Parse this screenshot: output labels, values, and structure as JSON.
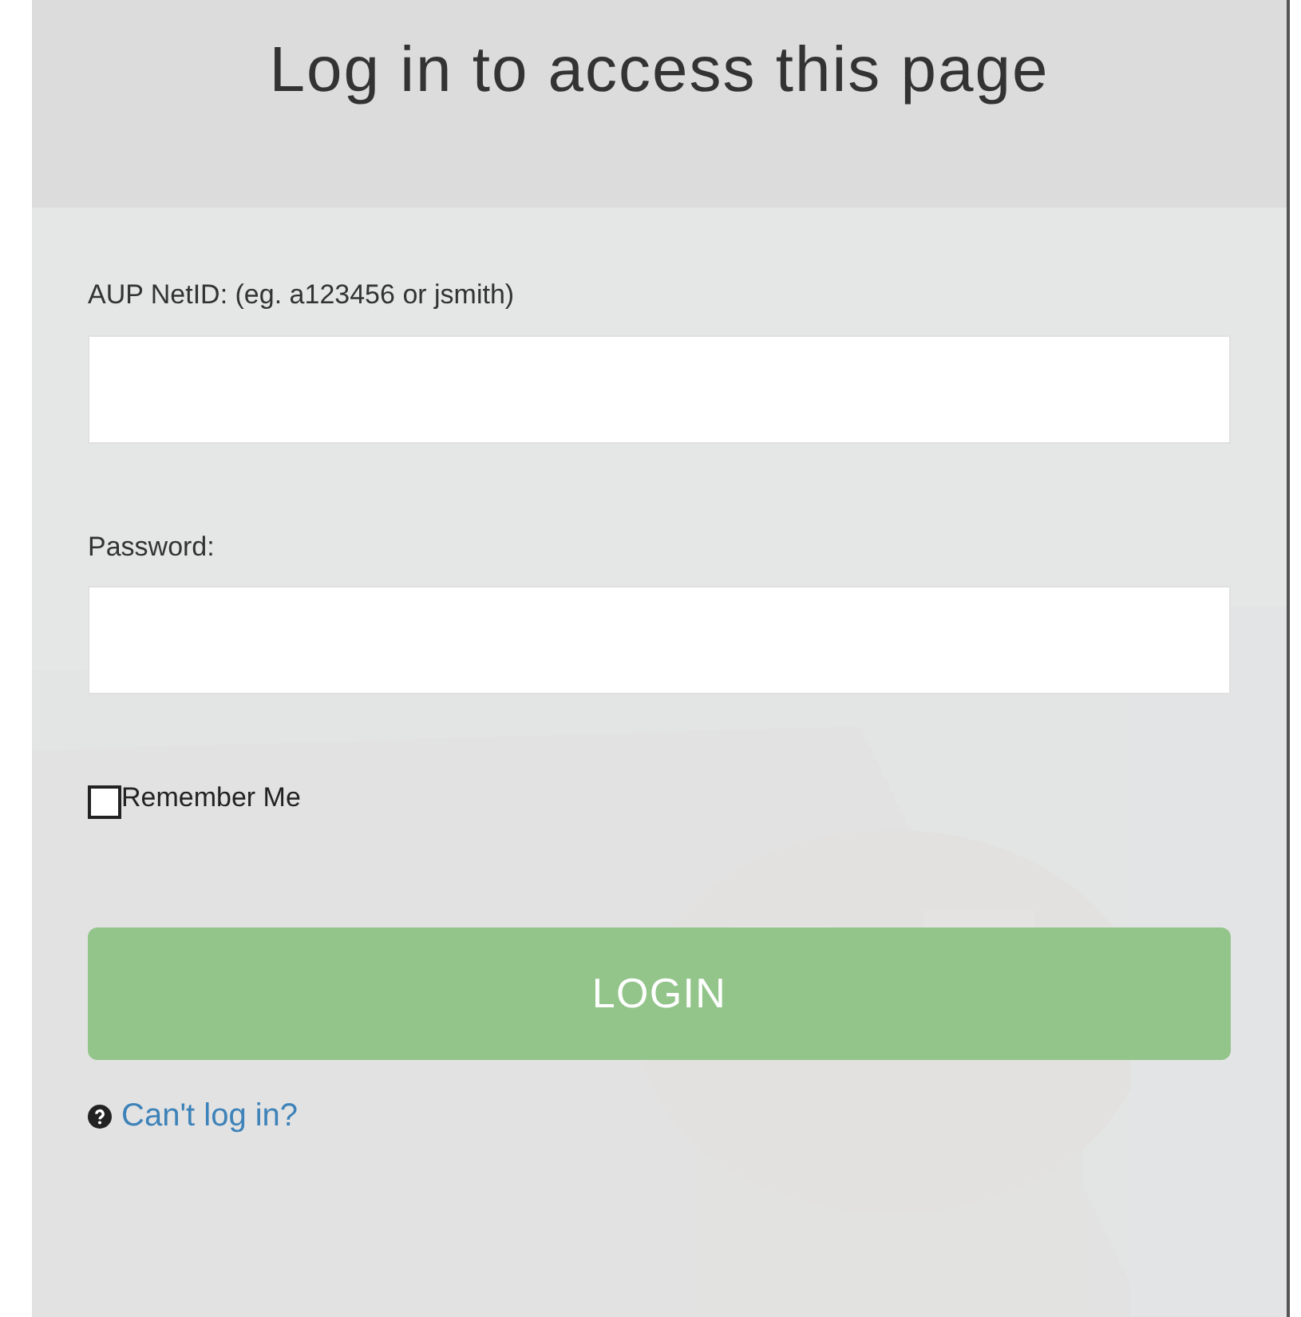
{
  "title": "Log in to access this page",
  "fields": [
    {
      "label": "AUP NetID: (eg. a123456 or jsmith)"
    },
    {
      "label": "Password:"
    }
  ],
  "remember": {
    "label": "Remember Me",
    "checked": false
  },
  "login_button": "LOGIN",
  "help_link": "Can't log in?"
}
